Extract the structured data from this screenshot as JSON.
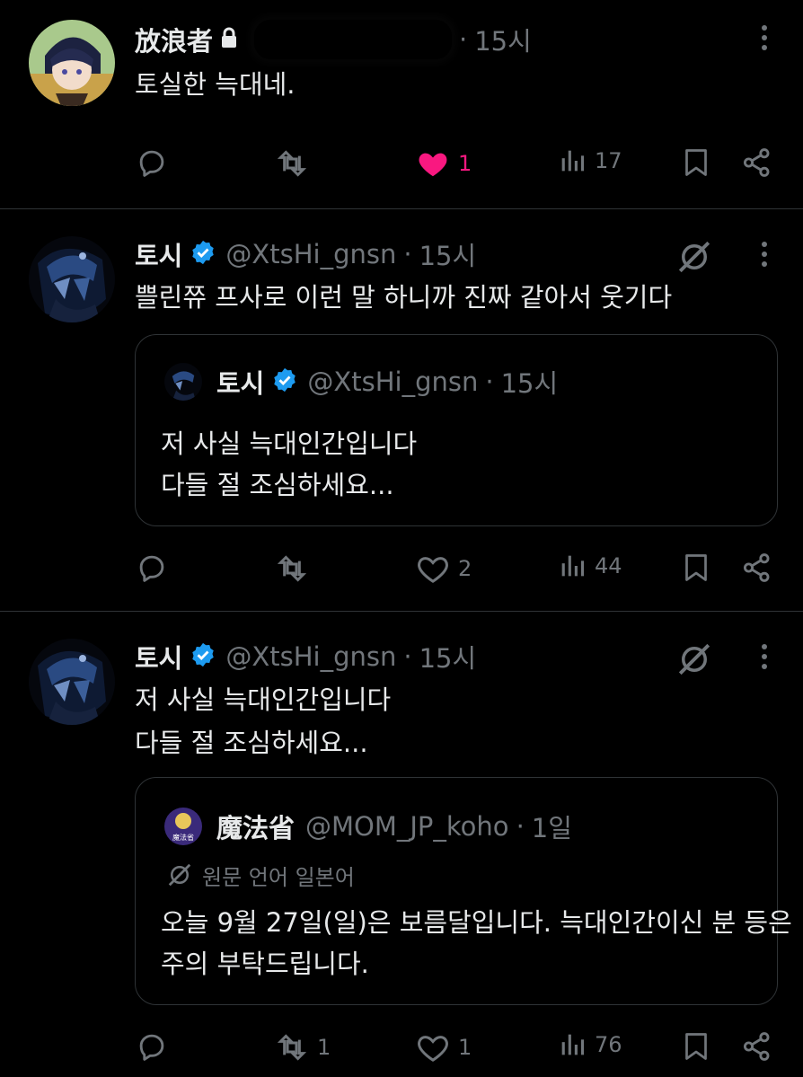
{
  "tweets": [
    {
      "name": "放浪者",
      "time": "15시",
      "text": "토실한 늑대네.",
      "actions": {
        "reply": "",
        "retweet": "",
        "like": "1",
        "views": "17"
      }
    },
    {
      "name": "토시",
      "handle": "@XtsHi_gnsn",
      "time": "15시",
      "text": "쁠린쮸 프사로 이런 말 하니까 진짜 같아서 웃기다",
      "quote": {
        "name": "토시",
        "handle": "@XtsHi_gnsn",
        "time": "15시",
        "line1": "저 사실 늑대인간입니다",
        "line2": "다들 절 조심하세요..."
      },
      "actions": {
        "reply": "",
        "retweet": "",
        "like": "2",
        "views": "44"
      }
    },
    {
      "name": "토시",
      "handle": "@XtsHi_gnsn",
      "time": "15시",
      "line1": "저 사실 늑대인간입니다",
      "line2": "다들 절 조심하세요...",
      "quote": {
        "name": "魔法省",
        "handle": "@MOM_JP_koho",
        "time": "1일",
        "translate_label": "원문 언어 일본어",
        "line1": "오늘 9월 27일(일)은 보름달입니다. 늑대인간이신 분 등은",
        "line2": "주의 부탁드립니다.",
        "avatar_text": "魔法省"
      },
      "actions": {
        "reply": "",
        "retweet": "1",
        "like": "1",
        "views": "76"
      }
    }
  ],
  "colors": {
    "like_active": "#f91880",
    "verified": "#1d9bf0",
    "muted": "#71767b",
    "border": "#2f3336"
  }
}
